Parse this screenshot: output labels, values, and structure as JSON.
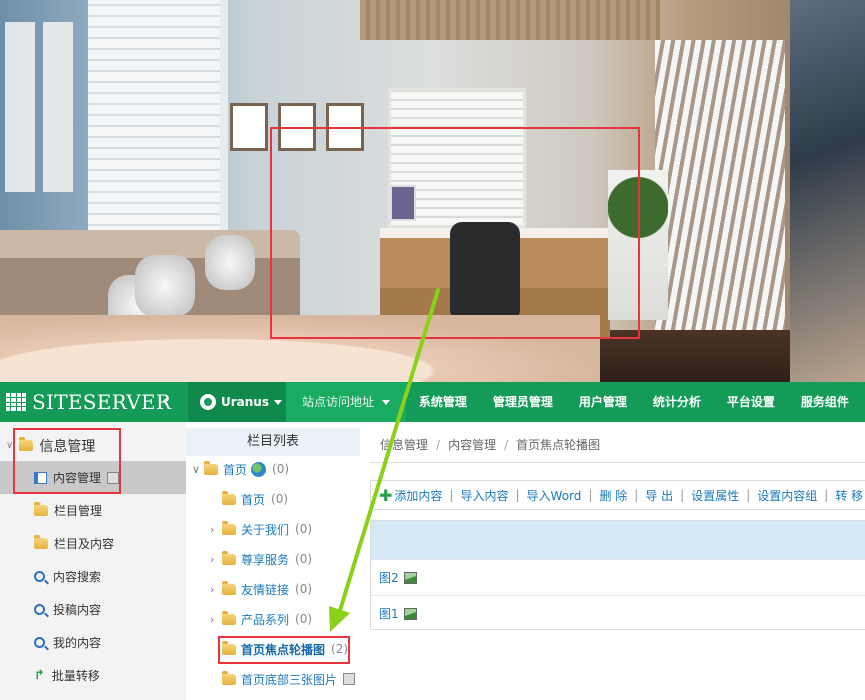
{
  "colors": {
    "nav_green": "#139b57",
    "annotation_red": "#e8343d",
    "arrow_green": "#8bd11a",
    "link_blue": "#1a7abf"
  },
  "brand": {
    "name": "SITESERVER",
    "collapse_icon": "chevron-left-icon"
  },
  "site_switcher": {
    "label": "Uranus",
    "icon": "globe-icon"
  },
  "nav": {
    "items": [
      {
        "label": "站点访问地址",
        "active": true
      },
      {
        "label": "系统管理"
      },
      {
        "label": "管理员管理"
      },
      {
        "label": "用户管理"
      },
      {
        "label": "统计分析"
      },
      {
        "label": "平台设置"
      },
      {
        "label": "服务组件"
      }
    ]
  },
  "sidebar": {
    "group": "信息管理",
    "items": [
      {
        "label": "内容管理",
        "icon": "document-icon",
        "selected": true
      },
      {
        "label": "栏目管理",
        "icon": "folder-icon"
      },
      {
        "label": "栏目及内容",
        "icon": "folder-icon"
      },
      {
        "label": "内容搜索",
        "icon": "search-icon"
      },
      {
        "label": "投稿内容",
        "icon": "search-icon"
      },
      {
        "label": "我的内容",
        "icon": "search-icon"
      },
      {
        "label": "批量转移",
        "icon": "arrow-icon"
      }
    ]
  },
  "tree": {
    "header": "栏目列表",
    "nodes": [
      {
        "label": "首页",
        "count": "(0)"
      },
      {
        "label": "首页",
        "count": "(0)"
      },
      {
        "label": "关于我们",
        "count": "(0)"
      },
      {
        "label": "尊享服务",
        "count": "(0)"
      },
      {
        "label": "友情链接",
        "count": "(0)"
      },
      {
        "label": "产品系列",
        "count": "(0)"
      },
      {
        "label": "首页焦点轮播图",
        "count": "(2)"
      },
      {
        "label": "首页底部三张图片",
        "count": ""
      }
    ]
  },
  "breadcrumb": [
    "信息管理",
    "内容管理",
    "首页焦点轮播图"
  ],
  "toolbar": {
    "buttons": [
      "添加内容",
      "导入内容",
      "导入Word",
      "删 除",
      "导 出",
      "设置属性",
      "设置内容组",
      "转 移"
    ]
  },
  "content_rows": [
    {
      "title": "图2"
    },
    {
      "title": "图1"
    }
  ]
}
